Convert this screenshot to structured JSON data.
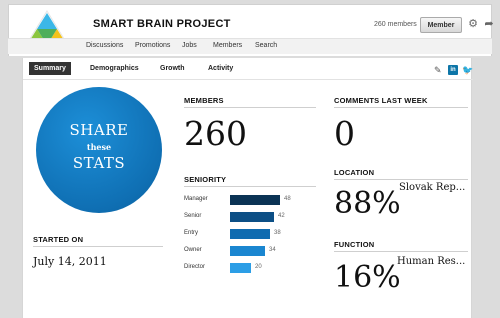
{
  "group": {
    "name": "SMART BRAIN PROJECT",
    "member_count": "260 members",
    "member_button": "Member"
  },
  "icons": {
    "logo": "triangle-logo",
    "settings": "gear-icon",
    "share": "share-arrow-icon",
    "edit": "pencil-icon",
    "linkedin": "linkedin-icon",
    "twitter": "twitter-bird-icon"
  },
  "nav": [
    "Discussions",
    "Promotions",
    "Jobs",
    "Members",
    "Search"
  ],
  "tabs": [
    "Summary",
    "Demographics",
    "Growth",
    "Activity"
  ],
  "active_tab": "Summary",
  "linkedin_text": "in",
  "share_circle": {
    "line1": "SHARE",
    "line2": "these",
    "line3": "STATS"
  },
  "members": {
    "label": "MEMBERS",
    "value": "260"
  },
  "comments": {
    "label": "COMMENTS LAST WEEK",
    "value": "0"
  },
  "started": {
    "label": "STARTED ON",
    "value": "July 14, 2011"
  },
  "seniority": {
    "label": "SENIORITY",
    "rows": [
      {
        "name": "Manager",
        "value": 48,
        "color": "#0b3355"
      },
      {
        "name": "Senior",
        "value": 42,
        "color": "#0c4f86"
      },
      {
        "name": "Entry",
        "value": 38,
        "color": "#0f6bb0"
      },
      {
        "name": "Owner",
        "value": 34,
        "color": "#1a86d0"
      },
      {
        "name": "Director",
        "value": 20,
        "color": "#2c9ee6"
      }
    ]
  },
  "location": {
    "label": "LOCATION",
    "percent": "88%",
    "name": "Slovak Rep..."
  },
  "function": {
    "label": "FUNCTION",
    "percent": "16%",
    "name": "Human Res..."
  },
  "colors": {
    "accent": "#0f6fb3",
    "header_bg": "#ffffff",
    "page_bg": "#dcdcdc"
  }
}
